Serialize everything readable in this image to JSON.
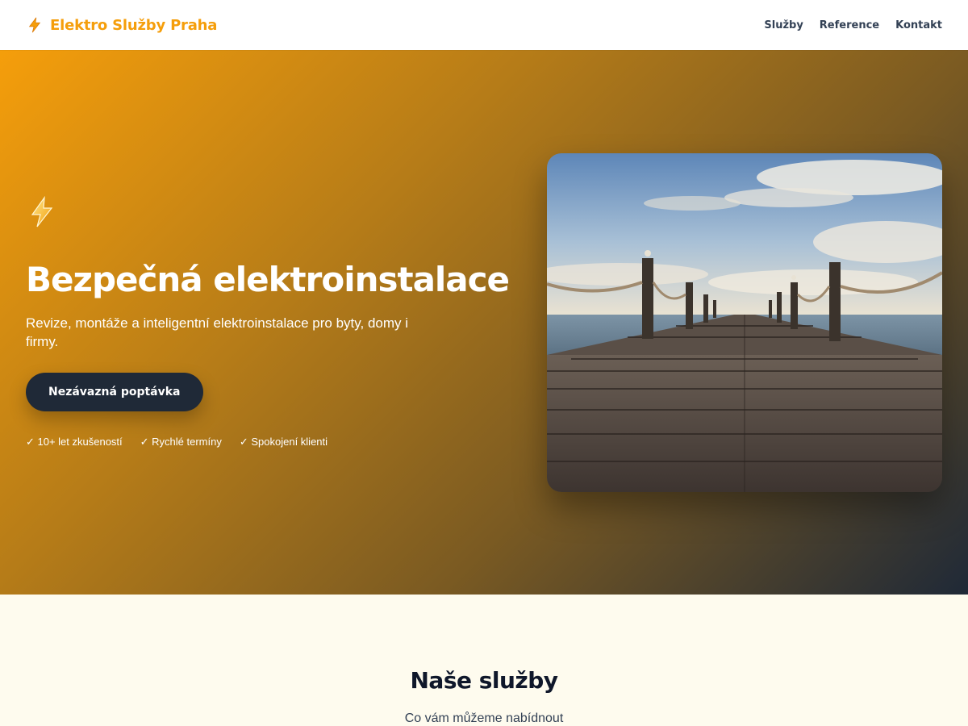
{
  "header": {
    "brand": "Elektro Služby Praha",
    "nav": [
      {
        "label": "Služby"
      },
      {
        "label": "Reference"
      },
      {
        "label": "Kontakt"
      }
    ]
  },
  "hero": {
    "icon": "lightning-bolt-icon",
    "title": "Bezpečná elektroinstalace",
    "subtitle": "Revize, montáže a inteligentní elektroinstalace pro byty, domy i firmy.",
    "cta_label": "Nezávazná poptávka",
    "badges": [
      "✓ 10+ let zkušeností",
      "✓ Rychlé termíny",
      "✓ Spokojení klienti"
    ],
    "image": "pier-over-sea-photo"
  },
  "services": {
    "title": "Naše služby",
    "subtitle": "Co vám můžeme nabídnout"
  },
  "colors": {
    "brand": "#f59e0b",
    "dark": "#1f2937",
    "section_bg": "#fefbee"
  }
}
